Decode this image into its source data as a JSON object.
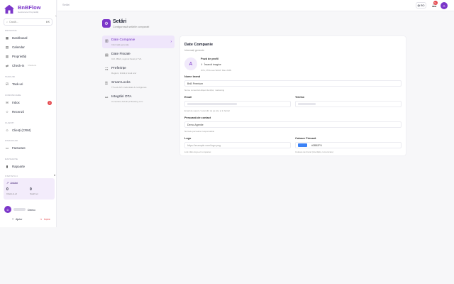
{
  "app": {
    "name": "BnBFlow",
    "tagline": "Gestionare Proprietăți"
  },
  "search": {
    "placeholder": "Caută...",
    "shortcut": "⌘K"
  },
  "sidebar": {
    "sections": [
      {
        "title": "Principal",
        "items": [
          {
            "label": "Dashboard",
            "icon": "dashboard-icon"
          },
          {
            "label": "Calendar",
            "icon": "calendar-icon"
          },
          {
            "label": "Proprietăți",
            "icon": "building-icon"
          },
          {
            "label": "Check-in",
            "sub": "Check-out",
            "icon": "checkin-icon"
          }
        ]
      },
      {
        "title": "Taskuri",
        "items": [
          {
            "label": "Task-uri",
            "icon": "tasks-icon"
          }
        ]
      },
      {
        "title": "Comunicare",
        "items": [
          {
            "label": "Inbox",
            "icon": "inbox-icon",
            "badge": "3"
          },
          {
            "label": "Recenzii",
            "icon": "star-icon"
          }
        ]
      },
      {
        "title": "Clienți",
        "items": [
          {
            "label": "Clienți (CRM)",
            "icon": "users-icon"
          }
        ]
      },
      {
        "title": "Financiar",
        "items": [
          {
            "label": "Facturare",
            "icon": "invoice-icon"
          }
        ]
      },
      {
        "title": "Rapoarte",
        "items": [
          {
            "label": "Rapoarte",
            "icon": "chart-icon"
          }
        ]
      }
    ],
    "stats": {
      "section": "Statistici",
      "title": "Astăzi",
      "v1": "0",
      "l1": "Check-in-uri",
      "v2": "0",
      "l2": "Sosiri noi"
    },
    "user": {
      "initial": "D",
      "name": "Demo"
    },
    "footer": {
      "help": "Ajutor",
      "logout": "Ieșire"
    }
  },
  "topbar": {
    "breadcrumb": "Setări",
    "lang": "RO",
    "notif_count": "9+",
    "avatar": "A"
  },
  "page": {
    "title": "Setări",
    "subtitle": "Configurează setările companiei"
  },
  "tabs": [
    {
      "label": "Date Companie",
      "sub": "Informații generale",
      "icon": "building-icon",
      "active": true
    },
    {
      "label": "Date Fiscale",
      "sub": "CUI, IBAN, regimul fiscal și TVA",
      "icon": "fiscal-icon"
    },
    {
      "label": "Preferințe",
      "sub": "Regiuni, limbă și fusul orar",
      "icon": "sliders-icon"
    },
    {
      "label": "Smart Locks",
      "sub": "TTLock API credentials & configurare",
      "icon": "lock-icon"
    },
    {
      "label": "Integrări OTA",
      "sub": "Conectare Airbnb și Booking.com",
      "icon": "link-icon"
    }
  ],
  "panel": {
    "title": "Date Companie",
    "subtitle": "Informații generale",
    "logo_initial": "A",
    "logo_label": "Poză de profil",
    "upload": "Încarcă imagine",
    "upload_hint": "JPG, PNG sau WebP. Max 2MB.",
    "brand_label": "Nume brand",
    "brand_value": "BnB Premium",
    "brand_hint": "Nume comercial afișat clienților, marketing",
    "email_label": "Email",
    "email_hint": "Email de suport / rezervări de pe site și în facturi",
    "phone_label": "Telefon",
    "contact_label": "Persoană de contact",
    "contact_value": "Demo Agentie",
    "contact_hint": "Numele persoanei responsabile",
    "logo_url_label": "Logo",
    "logo_url_placeholder": "https://example.com/logo.png",
    "logo_url_hint": "Link către logo-ul companiei",
    "color_label": "Culoare Primară",
    "color_value": "#3B82F6",
    "color_hint": "Culoare de brand (interfață, comunicare)"
  }
}
